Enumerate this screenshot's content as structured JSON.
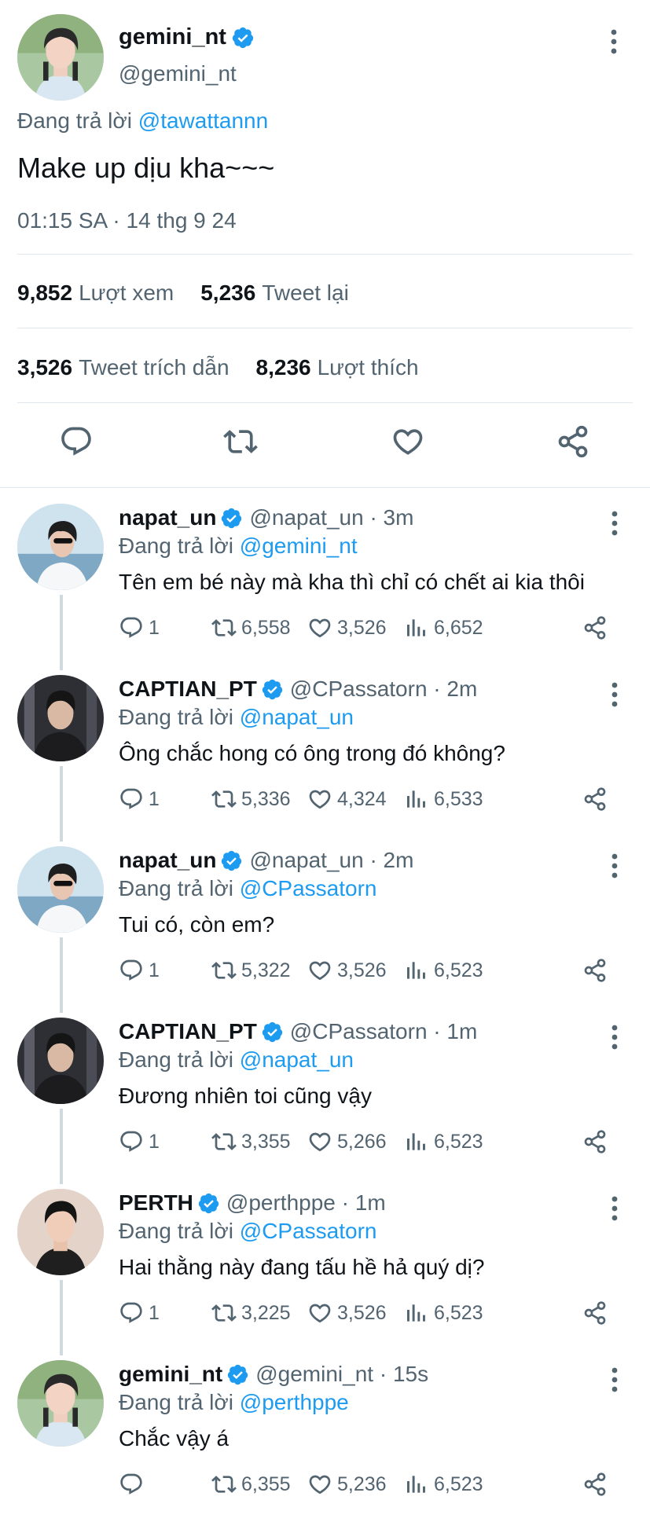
{
  "main_tweet": {
    "name": "gemini_nt",
    "handle": "@gemini_nt",
    "reply_prefix": "Đang trả lời",
    "reply_to": "@tawattannn",
    "text": "Make up dịu kha~~~",
    "timestamp": "01:15 SA · 14 thg 9 24",
    "stats": {
      "views_count": "9,852",
      "views_label": "Lượt xem",
      "retweets_count": "5,236",
      "retweets_label": "Tweet lại",
      "quotes_count": "3,526",
      "quotes_label": "Tweet trích dẫn",
      "likes_count": "8,236",
      "likes_label": "Lượt thích"
    },
    "actions": [
      "reply-icon",
      "retweet-icon",
      "like-icon",
      "share-icon"
    ]
  },
  "replies": [
    {
      "name": "napat_un",
      "handle": "@napat_un",
      "time": "3m",
      "reply_prefix": "Đang trả lời",
      "reply_to": "@gemini_nt",
      "text": "Tên em bé này mà kha thì chỉ có chết ai kia thôi",
      "replies": "1",
      "retweets": "6,558",
      "likes": "3,526",
      "views": "6,652",
      "avatar": "a"
    },
    {
      "name": "CAPTIAN_PT",
      "handle": "@CPassatorn",
      "time": "2m",
      "reply_prefix": "Đang trả lời",
      "reply_to": "@napat_un",
      "text": "Ông chắc hong có ông trong đó không?",
      "replies": "1",
      "retweets": "5,336",
      "likes": "4,324",
      "views": "6,533",
      "avatar": "b"
    },
    {
      "name": "napat_un",
      "handle": "@napat_un",
      "time": "2m",
      "reply_prefix": "Đang trả lời",
      "reply_to": "@CPassatorn",
      "text": "Tui có, còn em?",
      "replies": "1",
      "retweets": "5,322",
      "likes": "3,526",
      "views": "6,523",
      "avatar": "a"
    },
    {
      "name": "CAPTIAN_PT",
      "handle": "@CPassatorn",
      "time": "1m",
      "reply_prefix": "Đang trả lời",
      "reply_to": "@napat_un",
      "text": "Đương nhiên toi cũng vậy",
      "replies": "1",
      "retweets": "3,355",
      "likes": "5,266",
      "views": "6,523",
      "avatar": "b"
    },
    {
      "name": "PERTH",
      "handle": "@perthppe",
      "time": "1m",
      "reply_prefix": "Đang trả lời",
      "reply_to": "@CPassatorn",
      "text": "Hai thằng này đang tấu hề hả quý dị?",
      "replies": "1",
      "retweets": "3,225",
      "likes": "3,526",
      "views": "6,523",
      "avatar": "c"
    },
    {
      "name": "gemini_nt",
      "handle": "@gemini_nt",
      "time": "15s",
      "reply_prefix": "Đang trả lời",
      "reply_to": "@perthppe",
      "text": "Chắc vậy á",
      "replies": "",
      "retweets": "6,355",
      "likes": "5,236",
      "views": "6,523",
      "avatar": "d"
    }
  ],
  "colors": {
    "link": "#1d9bf0",
    "verified": "#1d9bf0",
    "muted": "#536471",
    "divider": "#e1e8ed"
  }
}
